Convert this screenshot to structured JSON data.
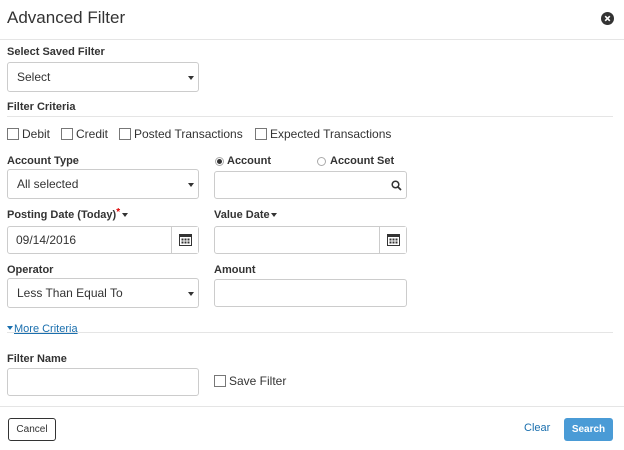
{
  "dialog": {
    "title": "Advanced Filter"
  },
  "saved_filter": {
    "label": "Select Saved Filter",
    "value": "Select"
  },
  "criteria": {
    "heading": "Filter Criteria"
  },
  "checkboxes": [
    {
      "label": "Debit",
      "checked": false
    },
    {
      "label": "Credit",
      "checked": false
    },
    {
      "label": "Posted Transactions",
      "checked": false
    },
    {
      "label": "Expected Transactions",
      "checked": false
    }
  ],
  "account_type": {
    "label": "Account Type",
    "value": "All selected"
  },
  "account_mode": {
    "options": [
      "Account",
      "Account Set"
    ],
    "selected": "Account"
  },
  "account_search": {
    "value": ""
  },
  "posting_date": {
    "label": "Posting Date (Today)",
    "required_mark": "*",
    "value": "09/14/2016"
  },
  "value_date": {
    "label": "Value Date",
    "value": ""
  },
  "operator": {
    "label": "Operator",
    "value": "Less Than Equal To"
  },
  "amount": {
    "label": "Amount",
    "value": ""
  },
  "more_criteria": {
    "label": "More Criteria"
  },
  "filter_name": {
    "label": "Filter Name",
    "value": ""
  },
  "save_filter": {
    "label": "Save Filter",
    "checked": false
  },
  "footer": {
    "cancel": "Cancel",
    "clear": "Clear",
    "search": "Search"
  },
  "colors": {
    "primary": "#4a9bd6",
    "link": "#1a6fae",
    "required": "#dd0000"
  }
}
